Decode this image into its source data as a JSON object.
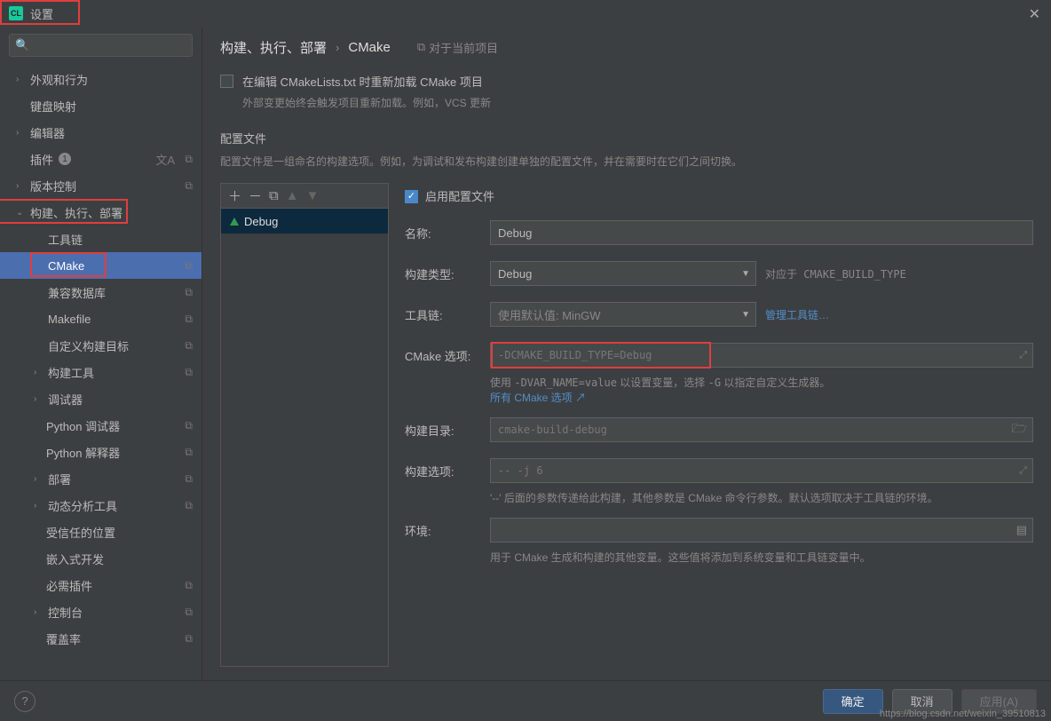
{
  "titlebar": {
    "app_initials": "CL",
    "title": "设置"
  },
  "sidebar": {
    "items": [
      {
        "label": "外观和行为",
        "expandable": true
      },
      {
        "label": "键盘映射"
      },
      {
        "label": "编辑器",
        "expandable": true
      },
      {
        "label": "插件",
        "badge": "1",
        "lang": true,
        "copy": true
      },
      {
        "label": "版本控制",
        "expandable": true,
        "copy": true
      },
      {
        "label": "构建、执行、部署",
        "expandable": true,
        "open": true
      },
      {
        "label": "工具链",
        "sub": true
      },
      {
        "label": "CMake",
        "sub": true,
        "selected": true,
        "copy": true
      },
      {
        "label": "兼容数据库",
        "sub": true,
        "copy": true
      },
      {
        "label": "Makefile",
        "sub": true,
        "copy": true
      },
      {
        "label": "自定义构建目标",
        "sub": true,
        "copy": true
      },
      {
        "label": "构建工具",
        "sub": true,
        "expandable": true,
        "copy": true
      },
      {
        "label": "调试器",
        "sub": true,
        "expandable": true
      },
      {
        "label": "Python 调试器",
        "subsub": true,
        "copy": true
      },
      {
        "label": "Python 解释器",
        "subsub": true,
        "copy": true
      },
      {
        "label": "部署",
        "sub": true,
        "expandable": true,
        "copy": true
      },
      {
        "label": "动态分析工具",
        "sub": true,
        "expandable": true,
        "copy": true
      },
      {
        "label": "受信任的位置",
        "subsub": true
      },
      {
        "label": "嵌入式开发",
        "subsub": true
      },
      {
        "label": "必需插件",
        "subsub": true,
        "copy": true
      },
      {
        "label": "控制台",
        "sub": true,
        "expandable": true,
        "copy": true
      },
      {
        "label": "覆盖率",
        "subsub": true,
        "copy": true
      }
    ]
  },
  "breadcrumb": {
    "root": "构建、执行、部署",
    "leaf": "CMake",
    "scope": "对于当前项目"
  },
  "reload": {
    "label": "在编辑 CMakeLists.txt 时重新加载 CMake 项目",
    "hint": "外部变更始终会触发项目重新加载。例如，VCS 更新"
  },
  "profiles_section": {
    "head": "配置文件",
    "desc": "配置文件是一组命名的构建选项。例如，为调试和发布构建创建单独的配置文件，并在需要时在它们之间切换。"
  },
  "profile_list": {
    "item": "Debug"
  },
  "form": {
    "enable_label": "启用配置文件",
    "name_label": "名称:",
    "name_value": "Debug",
    "buildtype_label": "构建类型:",
    "buildtype_value": "Debug",
    "buildtype_after": "对应于 CMAKE_BUILD_TYPE",
    "toolchain_label": "工具链:",
    "toolchain_value": "使用默认值: MinGW",
    "toolchain_link": "管理工具链…",
    "cmakeopts_label": "CMake 选项:",
    "cmakeopts_placeholder": "-DCMAKE_BUILD_TYPE=Debug",
    "cmakeopts_hint_pre": "使用 ",
    "cmakeopts_hint_mono": "-DVAR_NAME=value",
    "cmakeopts_hint_mid": " 以设置变量，选择 ",
    "cmakeopts_hint_mono2": "-G",
    "cmakeopts_hint_post": " 以指定自定义生成器。",
    "cmakeopts_link": "所有 CMake 选项 ↗",
    "builddir_label": "构建目录:",
    "builddir_placeholder": "cmake-build-debug",
    "buildopts_label": "构建选项:",
    "buildopts_placeholder": "-- -j 6",
    "buildopts_hint": "'--' 后面的参数传递给此构建，其他参数是 CMake 命令行参数。默认选项取决于工具链的环境。",
    "env_label": "环境:",
    "env_hint": "用于 CMake 生成和构建的其他变量。这些值将添加到系统变量和工具链变量中。"
  },
  "footer": {
    "ok": "确定",
    "cancel": "取消",
    "apply": "应用(A)"
  },
  "watermark": "https://blog.csdn.net/weixin_39510813"
}
